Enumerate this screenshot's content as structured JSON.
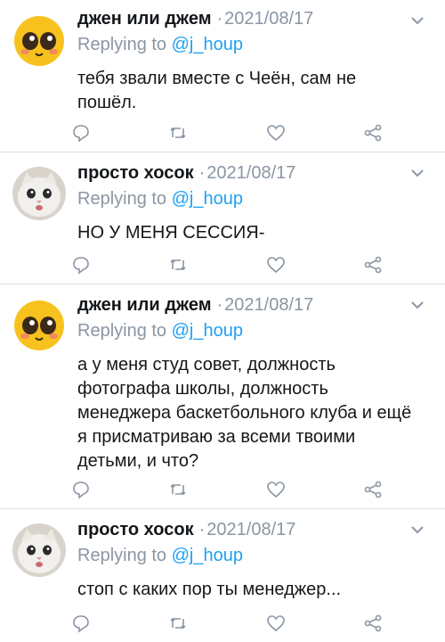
{
  "replying_to_label": "Replying to",
  "colors": {
    "link": "#1da1f2",
    "muted": "#8a96a3",
    "text": "#14171a",
    "divider": "#d9dde1"
  },
  "icons": {
    "reply": "reply-icon",
    "retweet": "retweet-icon",
    "like": "like-icon",
    "share": "share-icon",
    "more": "chevron-down-icon"
  },
  "tweets": [
    {
      "name": "джен или джем",
      "separator": "·",
      "date": "2021/08/17",
      "replying_to": "@j_houp",
      "text": "тебя звали вместе с Чеён, сам не\nпошёл.",
      "avatar": "emoji-avatar"
    },
    {
      "name": "просто хосок",
      "separator": "·",
      "date": "2021/08/17",
      "replying_to": "@j_houp",
      "text": "НО У МЕНЯ СЕССИЯ-",
      "avatar": "cat-avatar"
    },
    {
      "name": "джен или джем",
      "separator": "·",
      "date": "2021/08/17",
      "replying_to": "@j_houp",
      "text": "а у меня студ совет, должность\nфотографа школы, должность\nменеджера баскетбольного клуба и ещё\nя присматриваю за всеми твоими\nдетьми, и что?",
      "avatar": "emoji-avatar"
    },
    {
      "name": "просто хосок",
      "separator": "·",
      "date": "2021/08/17",
      "replying_to": "@j_houp",
      "text": "стоп с каких пор ты менеджер...",
      "avatar": "cat-avatar"
    }
  ]
}
